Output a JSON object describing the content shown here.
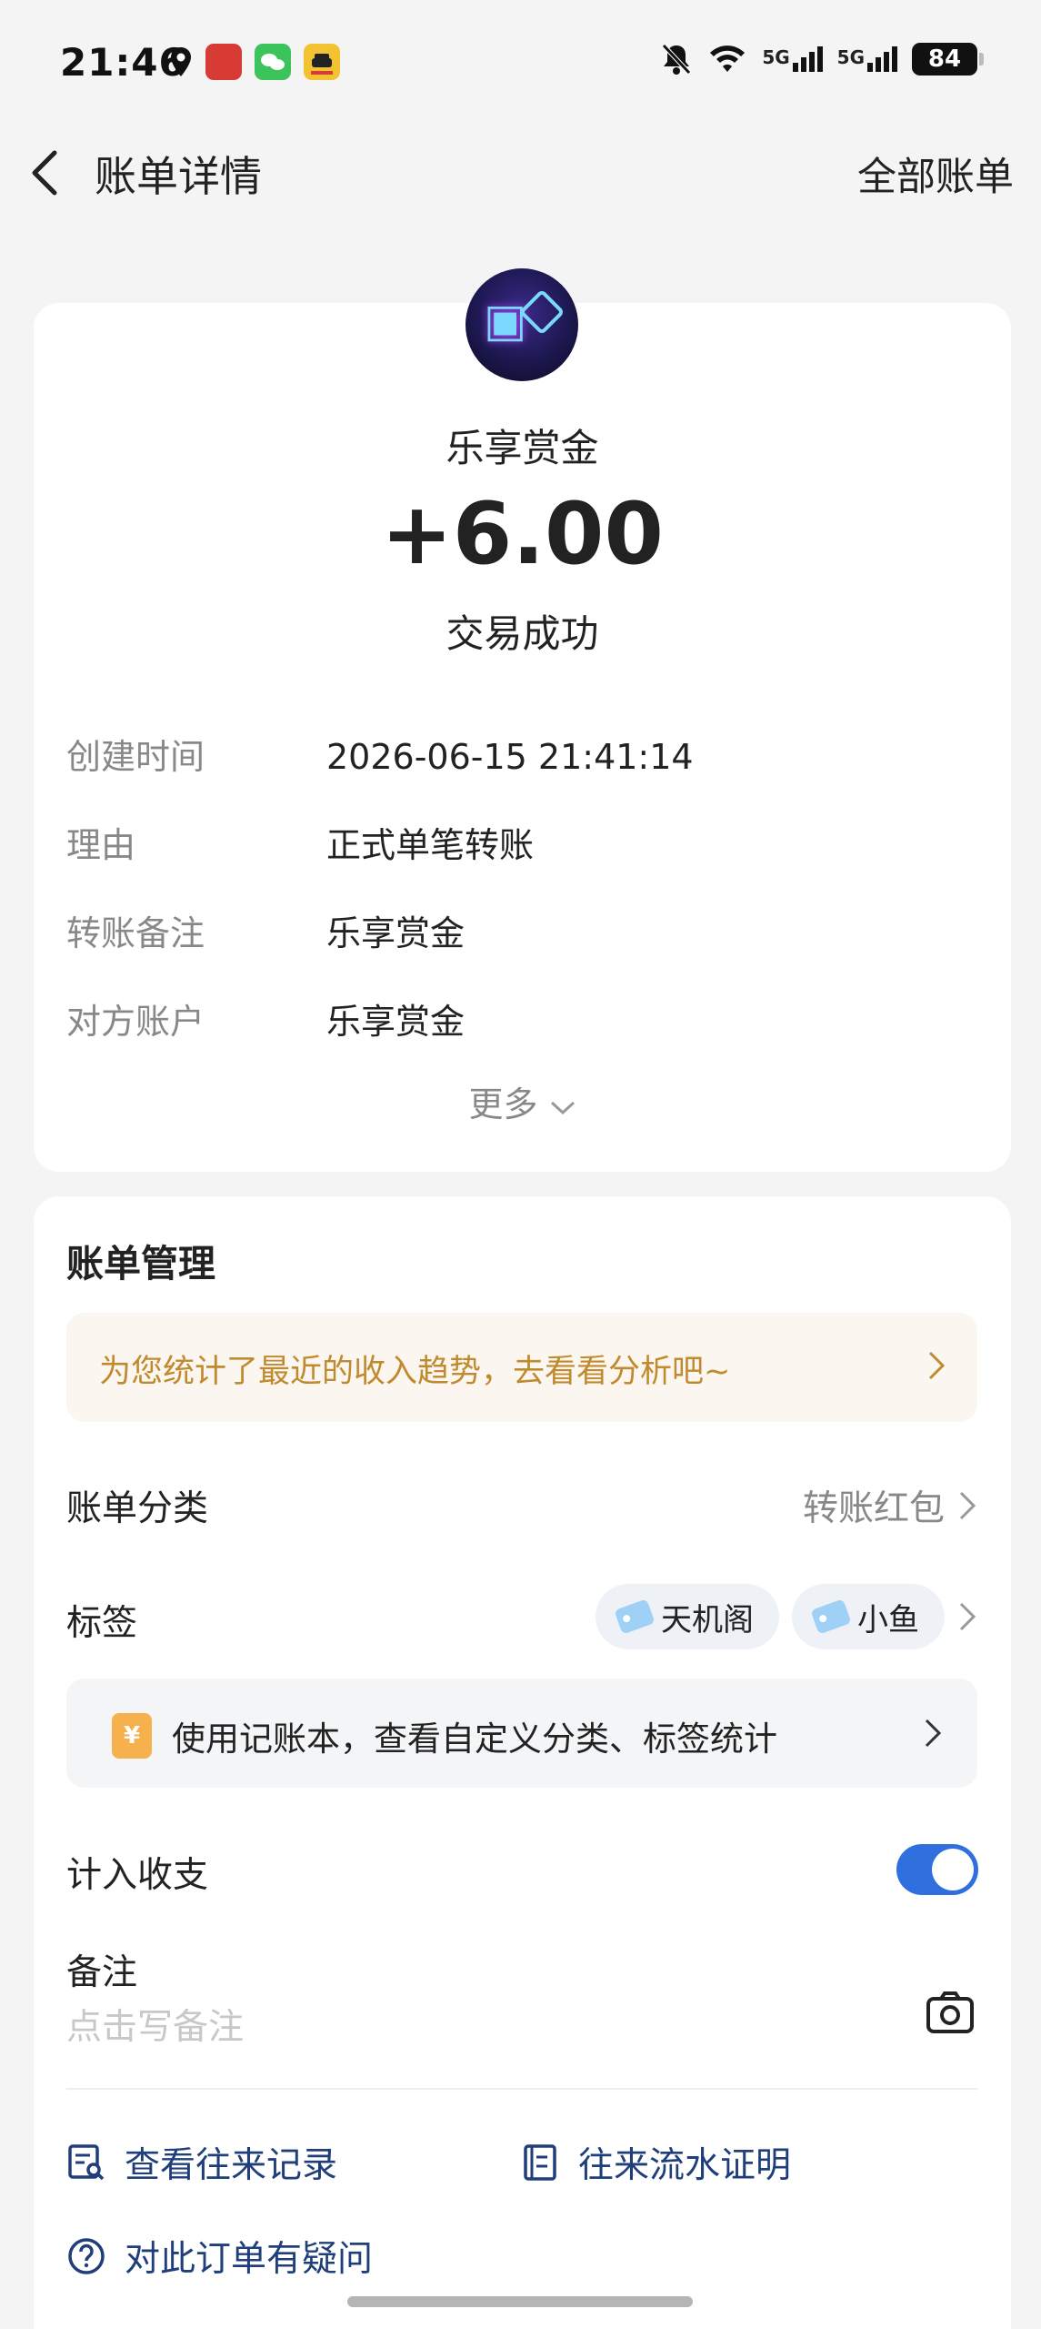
{
  "status_bar": {
    "time": "21:46",
    "battery": "84",
    "network_1": "5G",
    "network_2": "5G"
  },
  "header": {
    "title": "账单详情",
    "right_link": "全部账单"
  },
  "summary": {
    "payee": "乐享赏金",
    "amount": "+6.00",
    "status": "交易成功"
  },
  "details": [
    {
      "label": "创建时间",
      "value": "2026-06-15 21:41:14"
    },
    {
      "label": "理由",
      "value": "正式单笔转账"
    },
    {
      "label": "转账备注",
      "value": "乐享赏金"
    },
    {
      "label": "对方账户",
      "value": "乐享赏金"
    }
  ],
  "more_label": "更多",
  "management": {
    "title": "账单管理",
    "tip": "为您统计了最近的收入趋势，去看看分析吧~",
    "category_label": "账单分类",
    "category_value": "转账红包",
    "tags_label": "标签",
    "tags": [
      "天机阁",
      "小鱼"
    ],
    "ledger_prompt": "使用记账本，查看自定义分类、标签统计",
    "ledger_icon_text": "¥",
    "count_label": "计入收支",
    "count_enabled": true,
    "note_label": "备注",
    "note_placeholder": "点击写备注",
    "links": {
      "history": "查看往来记录",
      "proof": "往来流水证明",
      "question": "对此订单有疑问"
    }
  },
  "colors": {
    "accent": "#2f6fde",
    "link": "#1f3e7a",
    "tip_text": "#c08a2e",
    "tip_bg": "#fbf6ef"
  }
}
